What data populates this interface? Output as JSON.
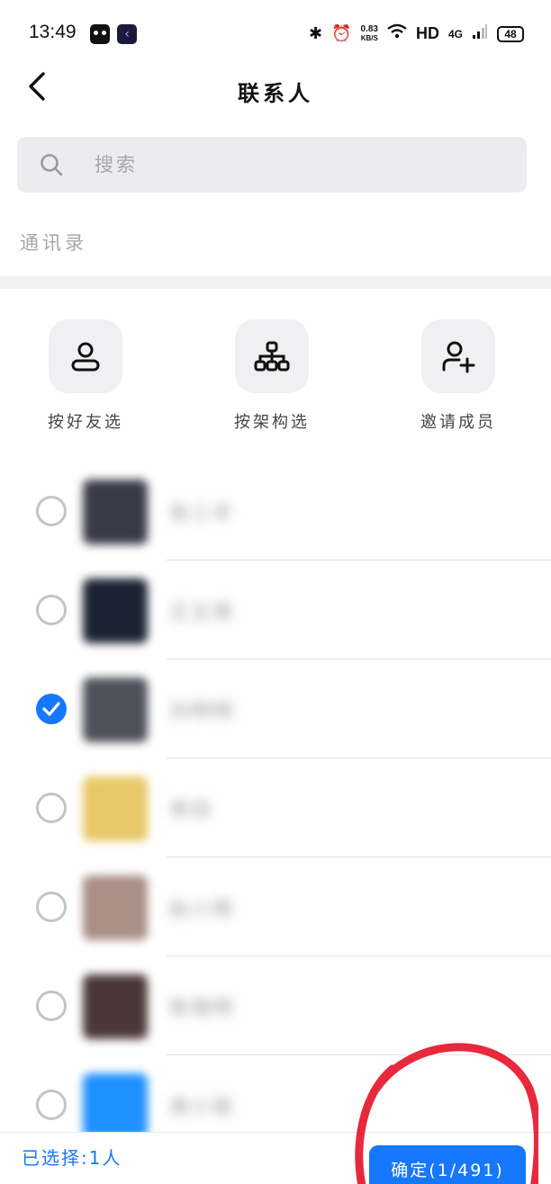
{
  "status_bar": {
    "time": "13:49",
    "net_speed_value": "0.83",
    "net_speed_unit": "KB/S",
    "hd": "HD",
    "network": "4G",
    "battery": "48"
  },
  "header": {
    "title": "联系人"
  },
  "search": {
    "placeholder": "搜索"
  },
  "section_label": "通讯录",
  "quick_actions": [
    {
      "label": "按好友选",
      "icon": "person-icon"
    },
    {
      "label": "按架构选",
      "icon": "org-chart-icon"
    },
    {
      "label": "邀请成员",
      "icon": "add-person-icon"
    }
  ],
  "contacts": [
    {
      "name": "张三丰",
      "checked": false,
      "avatar_color": "#3a3b48"
    },
    {
      "name": "王五哥",
      "checked": false,
      "avatar_color": "#1c2333"
    },
    {
      "name": "刘明明",
      "checked": true,
      "avatar_color": "#4d525a"
    },
    {
      "name": "李四",
      "checked": false,
      "avatar_color": "#e8c866"
    },
    {
      "name": "赵小雨",
      "checked": false,
      "avatar_color": "#a98f86"
    },
    {
      "name": "陈晓明",
      "checked": false,
      "avatar_color": "#4a3836"
    },
    {
      "name": "周小丽",
      "checked": false,
      "avatar_color": "#1e90ff"
    }
  ],
  "bottom_bar": {
    "selected_text": "已选择:1人",
    "confirm_label": "确定(1/491)"
  },
  "colors": {
    "accent": "#1677ff",
    "annotation": "#e8283c"
  }
}
